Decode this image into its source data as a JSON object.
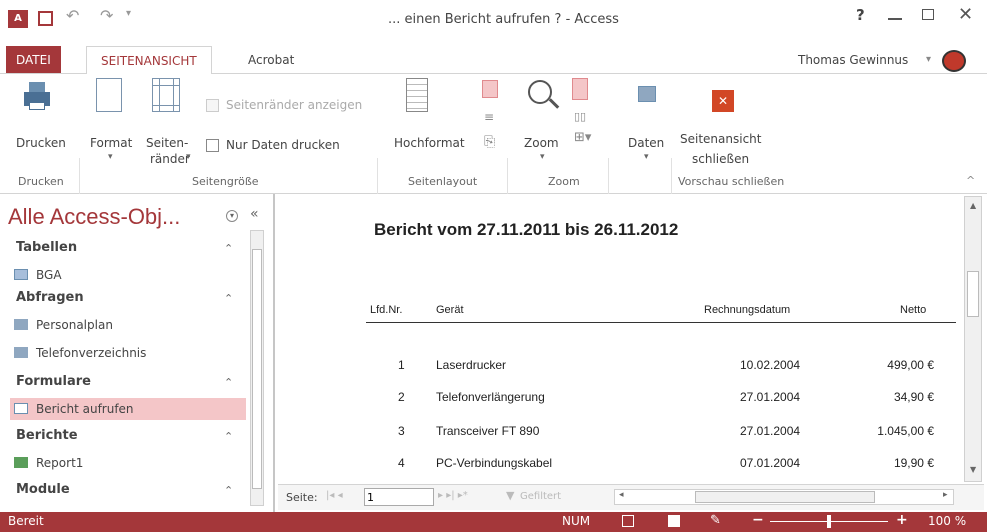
{
  "window": {
    "title": "... einen Bericht aufrufen ? - Access",
    "help": "?",
    "user": "Thomas Gewinnus"
  },
  "tabs": [
    {
      "label": "DATEI"
    },
    {
      "label": "SEITENANSICHT"
    },
    {
      "label": "Acrobat"
    }
  ],
  "ribbon": {
    "drucken": "Drucken",
    "format": "Format",
    "seitenraender_1": "Seiten-",
    "seitenraender_2": "ränder",
    "check_margins": "Seitenränder anzeigen",
    "check_data": "Nur Daten drucken",
    "hochformat": "Hochformat",
    "zoom": "Zoom",
    "daten": "Daten",
    "close_1": "Seitenansicht",
    "close_2": "schließen",
    "groups": {
      "drucken": "Drucken",
      "seitengroesse": "Seitengröße",
      "seitenlayout": "Seitenlayout",
      "zoom": "Zoom",
      "vorschau": "Vorschau schließen"
    }
  },
  "nav": {
    "title": "Alle Access-Obj...",
    "sections": {
      "tabellen": "Tabellen",
      "abfragen": "Abfragen",
      "formulare": "Formulare",
      "berichte": "Berichte",
      "module": "Module"
    },
    "items": {
      "bga": "BGA",
      "personalplan": "Personalplan",
      "telefon": "Telefonverzeichnis",
      "bericht": "Bericht aufrufen",
      "report1": "Report1"
    }
  },
  "report": {
    "title": "Bericht vom  27.11.2011 bis  26.11.2012",
    "headers": [
      "Lfd.Nr.",
      "Gerät",
      "Rechnungsdatum",
      "Netto"
    ],
    "rows": [
      [
        "1",
        "Laserdrucker",
        "10.02.2004",
        "499,00 €"
      ],
      [
        "2",
        "Telefonverlängerung",
        "27.01.2004",
        "34,90 €"
      ],
      [
        "3",
        "Transceiver FT 890",
        "27.01.2004",
        "1.045,00 €"
      ],
      [
        "4",
        "PC-Verbindungskabel",
        "07.01.2004",
        "19,90 €"
      ]
    ]
  },
  "pager": {
    "label": "Seite:",
    "value": "1",
    "filter": "Gefiltert"
  },
  "status": {
    "left": "Bereit",
    "num": "NUM",
    "zoom": "100 %"
  },
  "colors": {
    "accent": "#a4373a",
    "selected": "#f4c6c8"
  }
}
